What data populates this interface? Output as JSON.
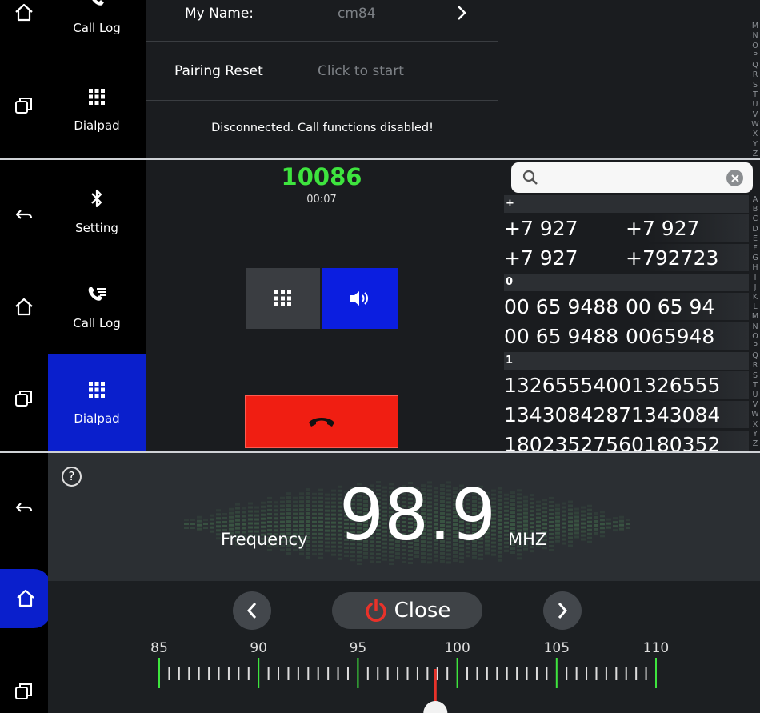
{
  "panel1": {
    "nav": {
      "call_log": "Call Log",
      "dialpad": "Dialpad"
    },
    "my_name_label": "My Name:",
    "my_name_value": "cm84",
    "pairing_label": "Pairing Reset",
    "pairing_action": "Click to start",
    "status": "Disconnected. Call functions disabled!",
    "alphabet": [
      "M",
      "N",
      "O",
      "P",
      "Q",
      "R",
      "S",
      "T",
      "U",
      "V",
      "W",
      "X",
      "Y",
      "Z"
    ]
  },
  "panel2": {
    "nav": {
      "setting": "Setting",
      "call_log": "Call Log",
      "dialpad": "Dialpad"
    },
    "number": "10086",
    "duration": "00:07",
    "search_placeholder": "",
    "contact_groups": [
      {
        "header": "+",
        "rows": [
          [
            "+7 927",
            "+7 927"
          ],
          [
            "+7 927",
            "+792723"
          ]
        ]
      },
      {
        "header": "0",
        "rows": [
          [
            "00 65 9488",
            "00 65 94"
          ],
          [
            "00 65 9488",
            "0065948"
          ]
        ]
      },
      {
        "header": "1",
        "rows": [
          [
            "13265554001326555",
            ""
          ],
          [
            "13430842871343084",
            ""
          ],
          [
            "18023527560180352",
            ""
          ]
        ]
      }
    ],
    "alphabet": [
      "A",
      "B",
      "C",
      "D",
      "E",
      "F",
      "G",
      "H",
      "I",
      "J",
      "K",
      "L",
      "M",
      "N",
      "O",
      "P",
      "Q",
      "R",
      "S",
      "T",
      "U",
      "V",
      "W",
      "X",
      "Y",
      "Z"
    ]
  },
  "panel3": {
    "frequency_label": "Frequency",
    "frequency_value": "98.9",
    "unit": "MHZ",
    "close_label": "Close",
    "help": "?",
    "scale_labels": [
      "85",
      "90",
      "95",
      "100",
      "105",
      "110"
    ],
    "scale_min": 85,
    "scale_max": 110,
    "current_frequency": 98.9
  },
  "colors": {
    "accent_blue": "#0a1fcc",
    "green": "#3ee43e",
    "end_call_red": "#f01e12",
    "speaker_blue": "#0b1ee0",
    "power_red": "#e8322a"
  }
}
